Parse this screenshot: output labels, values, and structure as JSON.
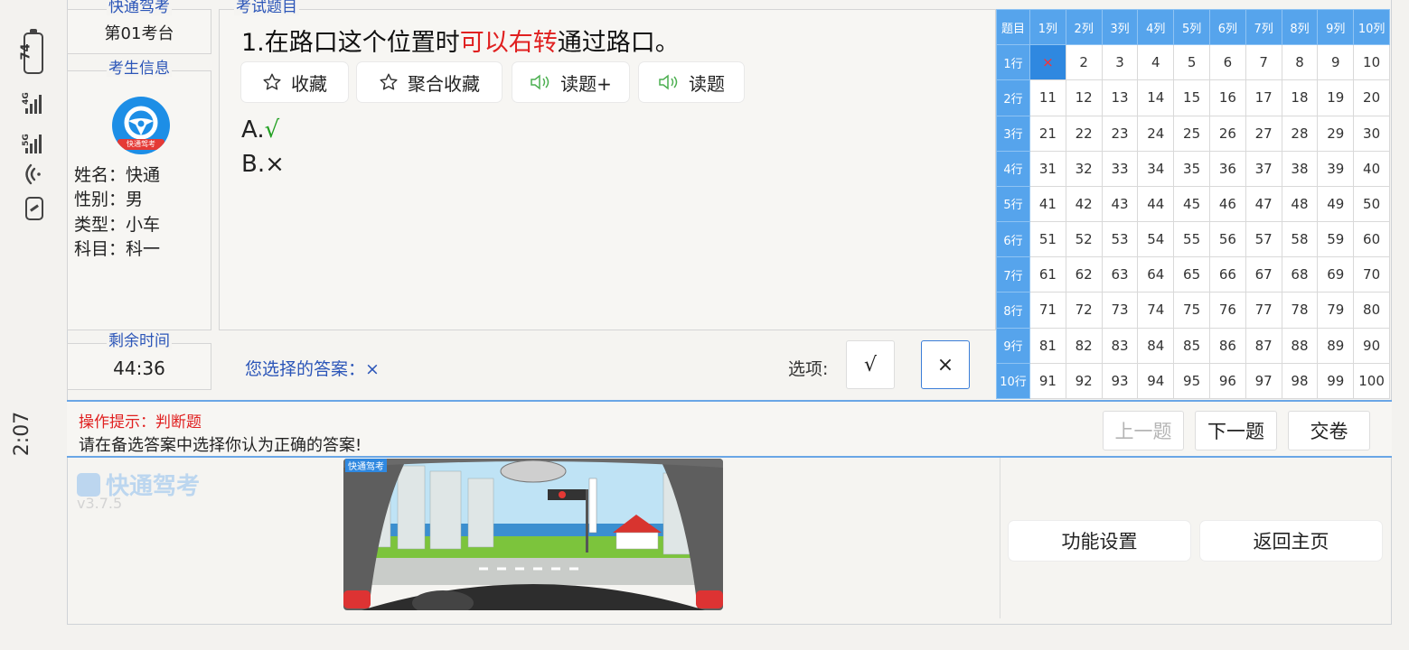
{
  "status_bar": {
    "time": "2:07",
    "battery": "74",
    "signal1": "4G",
    "signal2": "5G"
  },
  "exam_room": {
    "legend": "快通驾考",
    "value": "第01考台"
  },
  "student": {
    "legend": "考生信息",
    "avatar_badge": "快通驾考",
    "name": "姓名：快通",
    "gender": "性别：男",
    "type": "类型：小车",
    "subject": "科目：科一"
  },
  "remaining": {
    "legend": "剩余时间",
    "value": "44:36"
  },
  "question": {
    "legend": "考试题目",
    "prefix": "1.在路口这个位置时",
    "highlight": "可以右转",
    "suffix": "通过路口。",
    "buttons": {
      "favorite": "收藏",
      "aggregate_favorite": "聚合收藏",
      "read_plus": "读题+",
      "read": "读题"
    },
    "option_a_label": "A.",
    "option_a_mark": "√",
    "option_b": "B.×"
  },
  "answer": {
    "your_answer_label": "您选择的答案：×",
    "options_label": "选项:",
    "choice_true": "√",
    "choice_false": "×"
  },
  "grid": {
    "corner": "题目",
    "columns": [
      "1列",
      "2列",
      "3列",
      "4列",
      "5列",
      "6列",
      "7列",
      "8列",
      "9列",
      "10列"
    ],
    "rows": [
      "1行",
      "2行",
      "3行",
      "4行",
      "5行",
      "6行",
      "7行",
      "8行",
      "9行",
      "10行"
    ],
    "current_mark": "×"
  },
  "hint": {
    "title": "操作提示：判断题",
    "text": "请在备选答案中选择你认为正确的答案!"
  },
  "nav": {
    "prev": "上一题",
    "next": "下一题",
    "submit": "交卷"
  },
  "branding": {
    "logo": "快通驾考",
    "version": "v3.7.5",
    "scene_watermark": "快通驾考"
  },
  "footer": {
    "settings": "功能设置",
    "home": "返回主页"
  },
  "colors": {
    "accent": "#2b55b8",
    "header_blue": "#56a4ec",
    "highlight_red": "#e02020",
    "correct_green": "#22a022"
  }
}
